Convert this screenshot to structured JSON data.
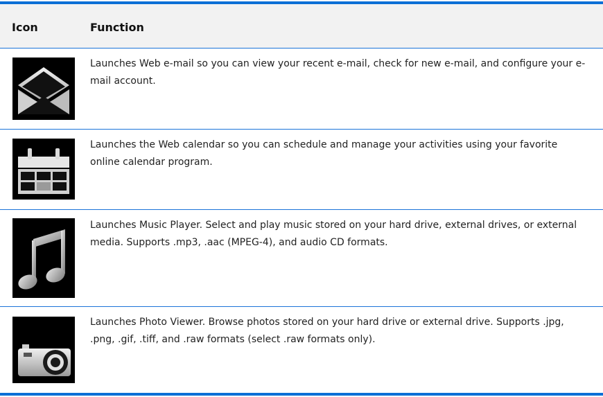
{
  "header": {
    "icon_label": "Icon",
    "function_label": "Function"
  },
  "rows": [
    {
      "icon": "envelope-icon",
      "text": "Launches Web e-mail so you can view your recent e-mail, check for new e-mail, and configure your e-mail account."
    },
    {
      "icon": "calendar-icon",
      "text": "Launches the Web calendar so you can schedule and manage your activities using your favorite online calendar program."
    },
    {
      "icon": "music-note-icon",
      "text": "Launches Music Player. Select and play music stored on your hard drive, external drives, or external media. Supports .mp3, .aac (MPEG-4), and audio CD formats."
    },
    {
      "icon": "camera-icon",
      "text": "Launches Photo Viewer. Browse photos stored on your hard drive or external drive. Supports .jpg, .png, .gif, .tiff, and .raw formats (select .raw formats only)."
    }
  ],
  "colors": {
    "rule_blue": "#0b6fd6",
    "header_bg": "#f2f2f2",
    "icon_bg": "#000000"
  }
}
